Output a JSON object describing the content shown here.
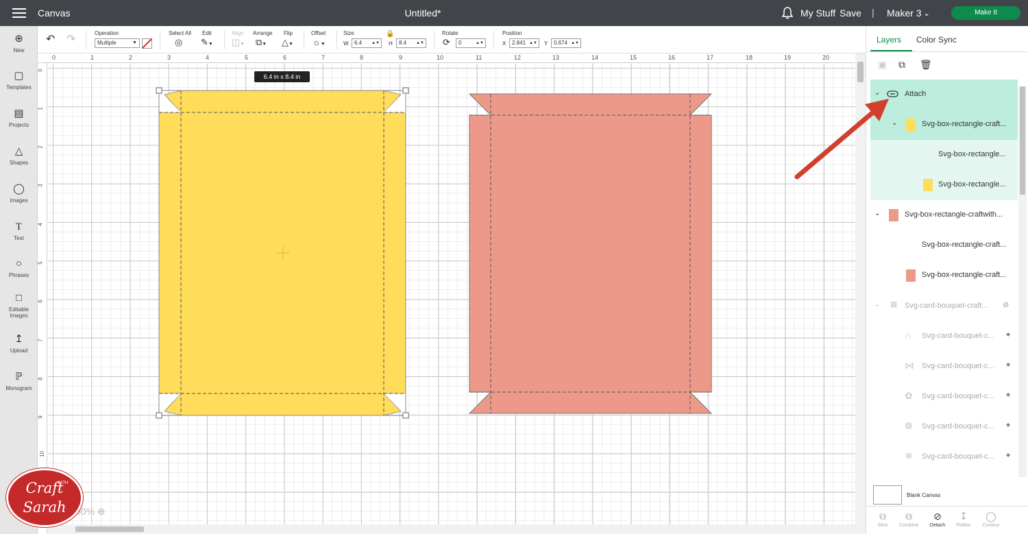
{
  "header": {
    "app_title": "Canvas",
    "doc_title": "Untitled*",
    "my_stuff": "My Stuff",
    "save": "Save",
    "separator": "|",
    "machine": "Maker 3",
    "make_it": "Make It"
  },
  "sidebar": {
    "items": [
      {
        "label": "New",
        "icon": "plus-circle-icon"
      },
      {
        "label": "Templates",
        "icon": "shirt-icon"
      },
      {
        "label": "Projects",
        "icon": "clipboard-icon"
      },
      {
        "label": "Shapes",
        "icon": "shapes-icon"
      },
      {
        "label": "Images",
        "icon": "lightbulb-icon"
      },
      {
        "label": "Text",
        "icon": "text-icon"
      },
      {
        "label": "Phrases",
        "icon": "speech-bubble-icon"
      },
      {
        "label": "Editable",
        "label2": "Images",
        "icon": "edit-image-icon"
      },
      {
        "label": "Upload",
        "icon": "upload-icon"
      },
      {
        "label": "Monogram",
        "icon": "monogram-icon"
      }
    ]
  },
  "toolbar": {
    "operation_label": "Operation",
    "operation_value": "Multiple",
    "select_all": "Select All",
    "edit": "Edit",
    "align": "Align",
    "arrange": "Arrange",
    "flip": "Flip",
    "offset": "Offset",
    "size_label": "Size",
    "w_label": "W",
    "w_value": "6.4",
    "h_label": "H",
    "h_value": "8.4",
    "rotate_label": "Rotate",
    "rotate_value": "0",
    "position_label": "Position",
    "x_label": "X",
    "x_value": "2.841",
    "y_label": "Y",
    "y_value": "0.674"
  },
  "canvas": {
    "ruler_top": [
      "0",
      "1",
      "2",
      "3",
      "4",
      "5",
      "6",
      "7",
      "8",
      "9",
      "10",
      "11",
      "12",
      "13",
      "14",
      "15",
      "16",
      "17",
      "18",
      "19",
      "20"
    ],
    "ruler_left": [
      "0",
      "1",
      "2",
      "3",
      "4",
      "5",
      "6",
      "7",
      "8",
      "9",
      "10"
    ],
    "size_tooltip": "6.4  in x 8.4  in",
    "zoom_text": "00%"
  },
  "logo": {
    "line1": "Craft",
    "with": "WITH",
    "line2": "Sarah"
  },
  "colors": {
    "yellow": "#ffdc5a",
    "salmon": "#ec998a",
    "accent": "#0d8a4c",
    "attach_bg": "#bdeedd",
    "attach_child_bg": "#e3f7f0",
    "arrow": "#d0402c"
  },
  "panel": {
    "tabs": [
      "Layers",
      "Color Sync"
    ],
    "layers": [
      {
        "label": "Attach",
        "icon": "attach-icon"
      },
      {
        "label": "Svg-box-rectangle-craft..."
      },
      {
        "label": "Svg-box-rectangle..."
      },
      {
        "label": "Svg-box-rectangle..."
      },
      {
        "label": "Svg-box-rectangle-craftwith..."
      },
      {
        "label": "Svg-box-rectangle-craft..."
      },
      {
        "label": "Svg-box-rectangle-craft..."
      },
      {
        "label": "Svg-card-bouquet-craft..."
      },
      {
        "label": "Svg-card-bouquet-c..."
      },
      {
        "label": "Svg-card-bouquet-c..."
      },
      {
        "label": "Svg-card-bouquet-c..."
      },
      {
        "label": "Svg-card-bouquet-c..."
      },
      {
        "label": "Svg-card-bouquet-c..."
      }
    ],
    "blank_canvas": "Blank Canvas",
    "bottom": [
      "Slice",
      "Combine",
      "Detach",
      "Flatten",
      "Contour"
    ]
  }
}
